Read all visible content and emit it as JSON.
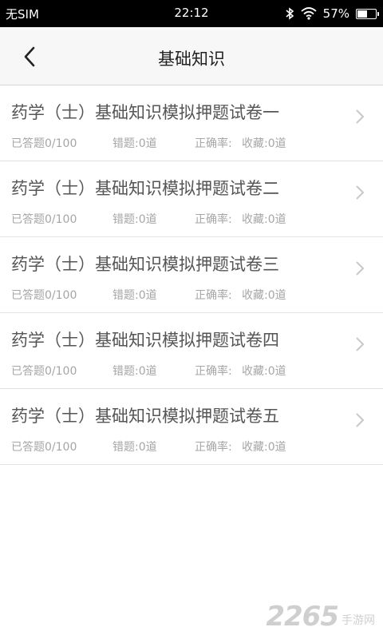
{
  "status_bar": {
    "carrier": "无SIM",
    "time": "22:12",
    "battery_text": "57%",
    "battery_level": 0.57
  },
  "nav": {
    "title": "基础知识",
    "back_icon": "chevron-left-icon"
  },
  "papers": [
    {
      "title": "药学（士）基础知识模拟押题试卷一",
      "answered": "已答题0/100",
      "wrong": "错题:0道",
      "accuracy": "正确率:",
      "favorites": "收藏:0道"
    },
    {
      "title": "药学（士）基础知识模拟押题试卷二",
      "answered": "已答题0/100",
      "wrong": "错题:0道",
      "accuracy": "正确率:",
      "favorites": "收藏:0道"
    },
    {
      "title": "药学（士）基础知识模拟押题试卷三",
      "answered": "已答题0/100",
      "wrong": "错题:0道",
      "accuracy": "正确率:",
      "favorites": "收藏:0道"
    },
    {
      "title": "药学（士）基础知识模拟押题试卷四",
      "answered": "已答题0/100",
      "wrong": "错题:0道",
      "accuracy": "正确率:",
      "favorites": "收藏:0道"
    },
    {
      "title": "药学（士）基础知识模拟押题试卷五",
      "answered": "已答题0/100",
      "wrong": "错题:0道",
      "accuracy": "正确率:",
      "favorites": "收藏:0道"
    }
  ],
  "watermark": {
    "number": "2265",
    "text": "手游网"
  },
  "colors": {
    "status_bg": "#000000",
    "nav_bg": "#f7f7f7",
    "title_text": "#555555",
    "meta_text": "#a6a6a6",
    "divider": "#e3e3e3"
  }
}
